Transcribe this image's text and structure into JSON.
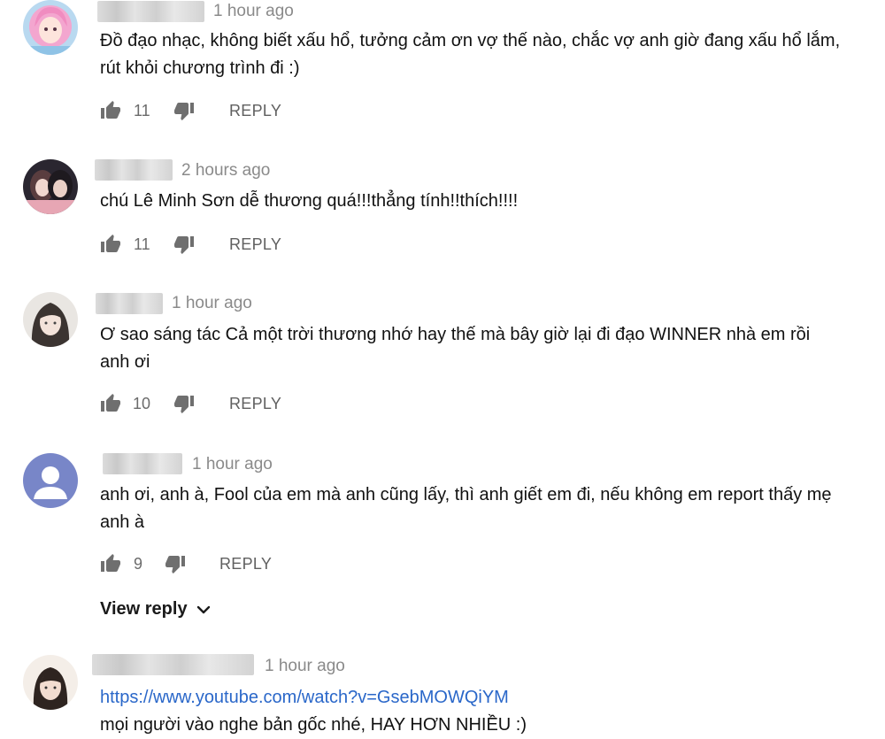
{
  "comments": [
    {
      "time": "1 hour ago",
      "text": "Đồ đạo nhạc, không biết xấu hổ, tưởng cảm ơn vợ thế nào, chắc vợ anh giờ đang xấu hổ lắm, rút khỏi chương trình đi :)",
      "likes": "11",
      "reply": "REPLY"
    },
    {
      "time": "2 hours ago",
      "text": "chú Lê Minh Sơn dễ thương quá!!!thẳng tính!!thích!!!!",
      "likes": "11",
      "reply": "REPLY"
    },
    {
      "time": "1 hour ago",
      "text": "Ơ sao sáng tác Cả một trời thương nhớ hay thế mà bây giờ lại đi đạo WINNER nhà em rồi anh ơi",
      "likes": "10",
      "reply": "REPLY"
    },
    {
      "time": "1 hour ago",
      "text": "anh ơi, anh à, Fool của em mà anh cũng lấy, thì anh giết em đi, nếu không em report thấy mẹ anh à",
      "likes": "9",
      "reply": "REPLY",
      "view_reply": "View reply"
    },
    {
      "time": "1 hour ago",
      "link": "https://www.youtube.com/watch?v=GsebMOWQiYM",
      "text": "mọi người vào nghe bản gốc nhé, HAY HƠN NHIỀU :)"
    }
  ],
  "icons": {
    "like": "thumbs-up-icon",
    "dislike": "thumbs-down-icon",
    "chevron": "chevron-down-icon",
    "default_avatar": "person-icon"
  },
  "colors": {
    "link": "#2a67c9",
    "default_avatar_bg": "#7886c8"
  }
}
